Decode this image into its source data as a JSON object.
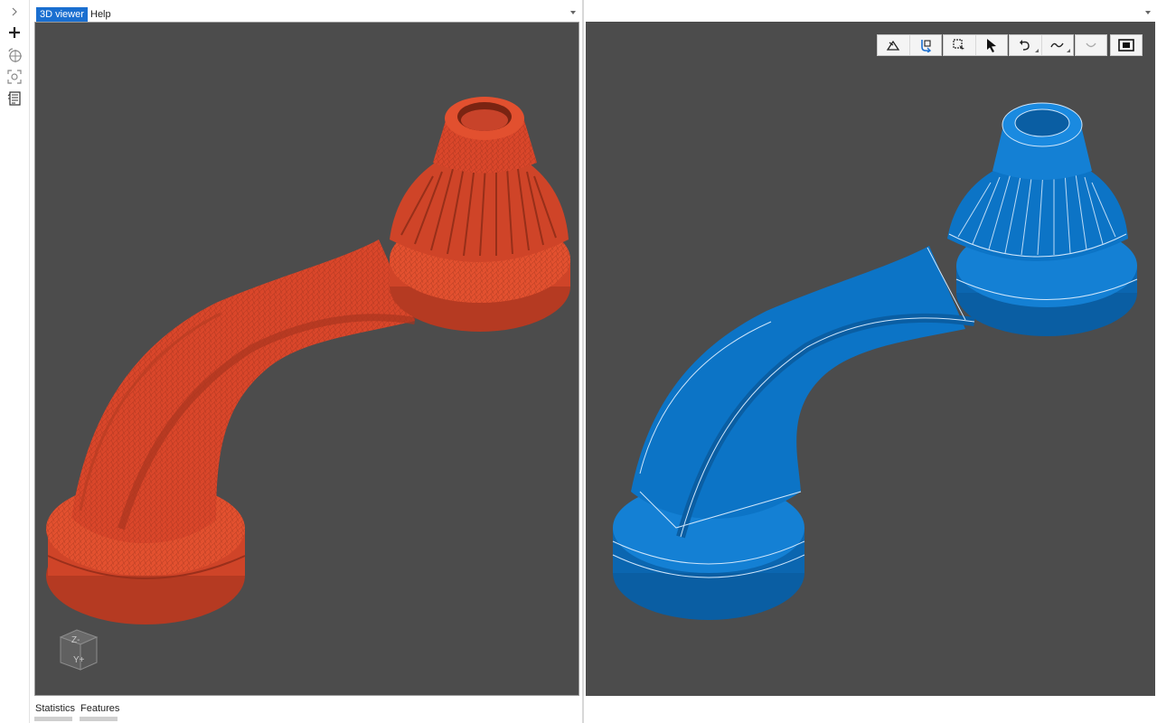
{
  "tabs": {
    "viewer": "3D viewer",
    "help": "Help"
  },
  "bottom_tabs": {
    "statistics": "Statistics",
    "features": "Features"
  },
  "nav_cube": {
    "face_top": "Z-",
    "face_front": "Y+"
  },
  "left_strip": [
    "expand-chevron-icon",
    "add-icon",
    "rotate-target-icon",
    "zoom-fit-icon",
    "properties-list-icon"
  ],
  "toolbar_groups": [
    [
      "normals-icon",
      "mesh-rotate-icon"
    ],
    [
      "select-region-icon",
      "select-pointer-icon"
    ],
    [
      "undo-curve-icon",
      "wave-icon"
    ],
    [
      "smile-icon"
    ],
    [
      "screenshot-icon"
    ]
  ],
  "colors": {
    "accent_tab": "#1a6fd0",
    "viewport_bg": "#4c4c4c",
    "mesh_model": "#d9462a",
    "cad_model": "#0c74c6"
  }
}
